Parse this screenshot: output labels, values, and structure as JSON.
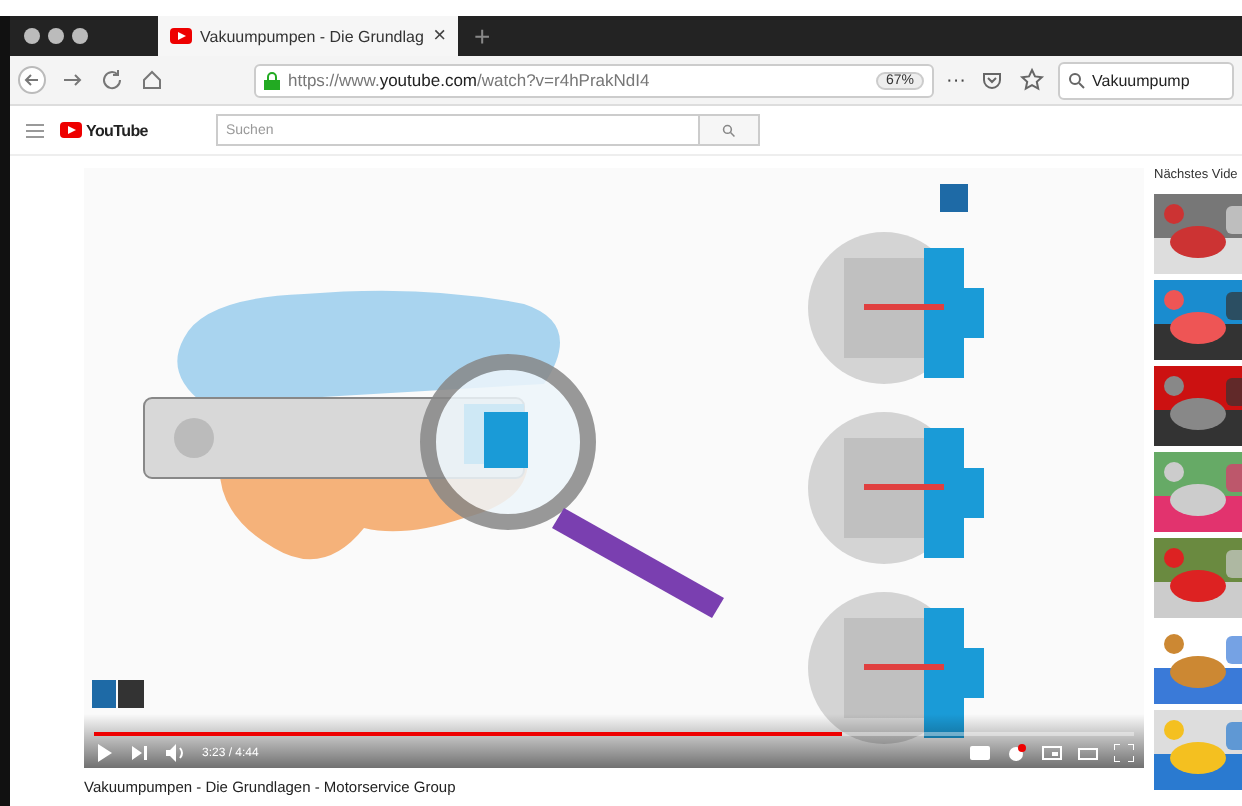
{
  "browser": {
    "tabs": [
      {
        "title": "Vakuumpumpen - Die Grundlag",
        "close": "×",
        "selected": true
      }
    ],
    "new_tab": "+",
    "url": "https://www.**youtube.com**/watch?v=r4hPrakNdI4",
    "zoom": "67%",
    "more": "···",
    "search_value": "Vakuumpump"
  },
  "youtube": {
    "logo": "YouTube",
    "search_placeholder": "Suchen"
  },
  "video": {
    "kind": "picture",
    "time": "3:23 / 4:44",
    "level": 0.72,
    "title": "Vakuumpumpen - Die Grundlagen - Motorservice Group"
  },
  "up_next": {
    "heading": "Nächstes Vide"
  }
}
